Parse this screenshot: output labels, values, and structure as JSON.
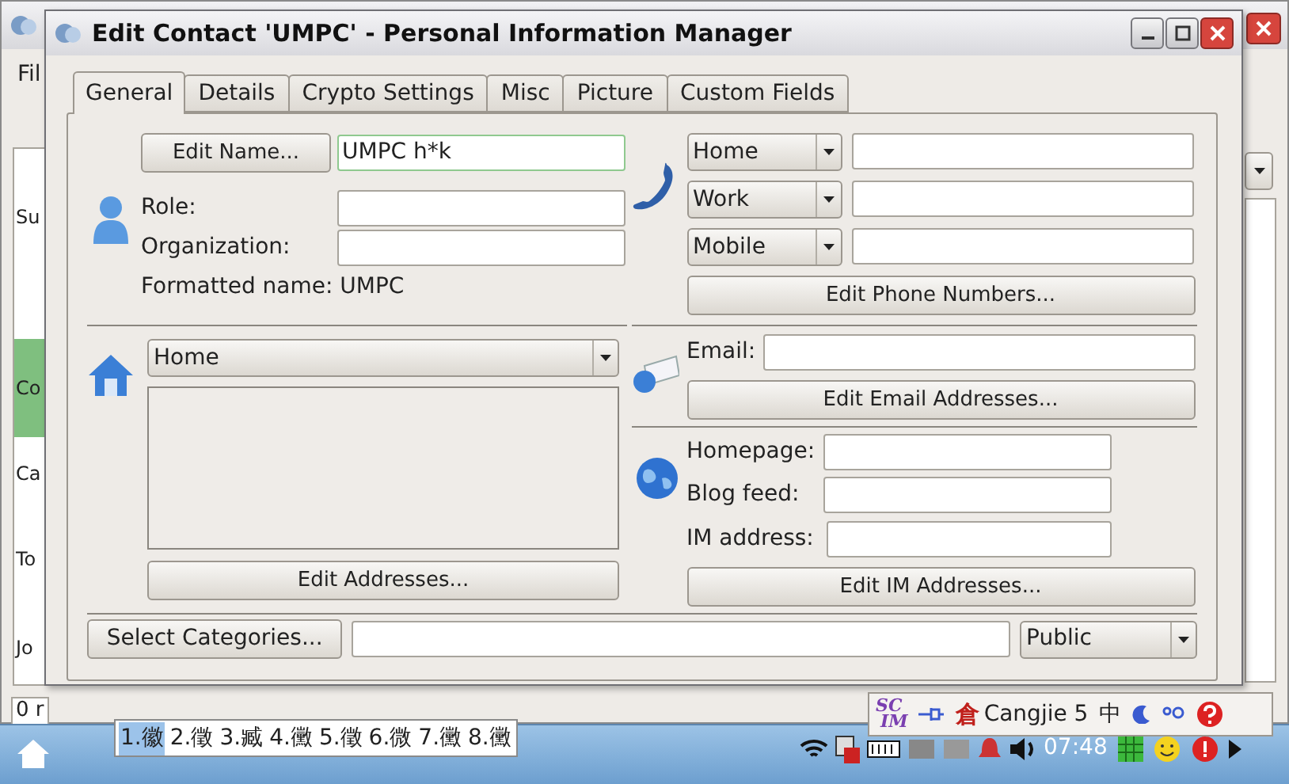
{
  "background_window": {
    "menu": "Fil",
    "sidebar_items": [
      {
        "label": "Su",
        "selected": false
      },
      {
        "label": "Co",
        "selected": true
      },
      {
        "label": "Ca",
        "selected": false
      },
      {
        "label": "To",
        "selected": false
      },
      {
        "label": "Jo",
        "selected": false
      }
    ],
    "status_bar": "0 r"
  },
  "dialog": {
    "title": "Edit Contact 'UMPC' - Personal Information Manager",
    "tabs": [
      {
        "label": "General",
        "selected": true
      },
      {
        "label": "Details",
        "selected": false
      },
      {
        "label": "Crypto Settings",
        "selected": false
      },
      {
        "label": "Misc",
        "selected": false
      },
      {
        "label": "Picture",
        "selected": false
      },
      {
        "label": "Custom Fields",
        "selected": false
      }
    ],
    "name": {
      "button": "Edit Name...",
      "value": "UMPC h*k"
    },
    "role": {
      "label": "Role:"
    },
    "organization": {
      "label": "Organization:"
    },
    "formatted_name": "Formatted name: UMPC",
    "address": {
      "type": "Home",
      "button": "Edit Addresses..."
    },
    "phones": [
      {
        "type": "Home"
      },
      {
        "type": "Work"
      },
      {
        "type": "Mobile"
      }
    ],
    "phone_button": "Edit Phone Numbers...",
    "email": {
      "label": "Email:",
      "button": "Edit Email Addresses..."
    },
    "homepage": {
      "label": "Homepage:"
    },
    "blog_feed": {
      "label": "Blog feed:"
    },
    "im": {
      "label": "IM address:",
      "button": "Edit IM Addresses..."
    },
    "categories_button": "Select Categories...",
    "security": "Public"
  },
  "candidate_bar": {
    "candidates": [
      {
        "label": "1.徽",
        "selected": true
      },
      {
        "label": "2.徵",
        "selected": false
      },
      {
        "label": "3.臧",
        "selected": false
      },
      {
        "label": "4.黴",
        "selected": false
      },
      {
        "label": "5.徵",
        "selected": false
      },
      {
        "label": "6.微",
        "selected": false
      },
      {
        "label": "7.黴",
        "selected": false
      },
      {
        "label": "8.黴",
        "selected": false
      }
    ]
  },
  "input_method": {
    "logo_top": "SC",
    "logo_bottom": "IM",
    "method_char": "倉",
    "method": "Cangjie 5",
    "mode": "中"
  },
  "taskbar": {
    "clock": "07:48"
  }
}
